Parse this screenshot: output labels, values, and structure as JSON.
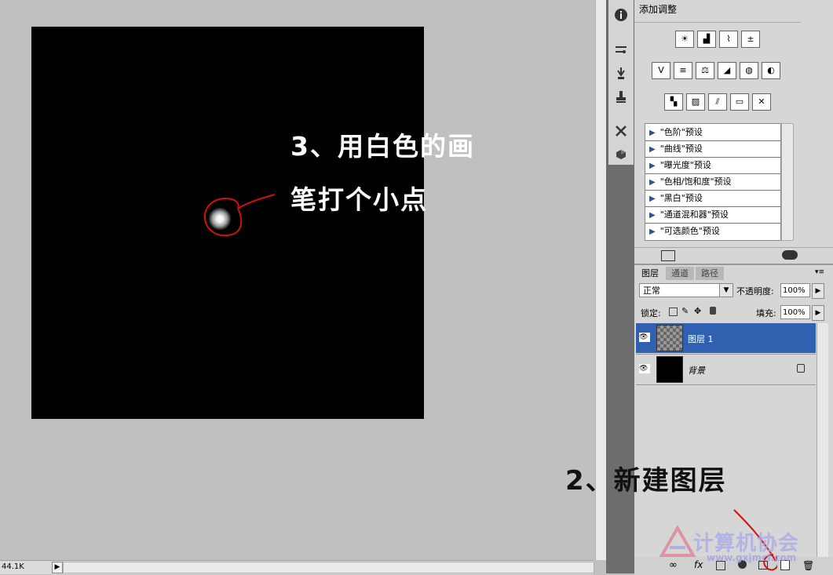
{
  "canvas": {
    "annotation_line1": "3、用白色的画",
    "annotation_line2": "笔打个小点"
  },
  "status": {
    "zoom": "44.1K",
    "arrow": "▶"
  },
  "layers_annotation": "2、新建图层",
  "adjustments": {
    "title": "添加调整",
    "row1_icons": [
      "brightness-icon",
      "levels-icon",
      "curves-icon",
      "exposure-icon"
    ],
    "row2_icons": [
      "vibrance-icon",
      "hue-saturation-icon",
      "color-balance-icon",
      "black-white-icon",
      "photo-filter-icon",
      "channel-mixer-icon"
    ],
    "row3_icons": [
      "invert-icon",
      "posterize-icon",
      "threshold-icon",
      "gradient-map-icon",
      "selective-color-icon"
    ],
    "presets": [
      "\"色阶\"预设",
      "\"曲线\"预设",
      "\"曝光度\"预设",
      "\"色相/饱和度\"预设",
      "\"黑白\"预设",
      "\"通道混和器\"预设",
      "\"可选颜色\"预设"
    ]
  },
  "layers": {
    "tabs": [
      "图层",
      "通道",
      "路径"
    ],
    "blend_mode": "正常",
    "opacity_label": "不透明度:",
    "opacity_value": "100%",
    "lock_label": "锁定:",
    "fill_label": "填充:",
    "fill_value": "100%",
    "items": [
      {
        "name": "图层 1",
        "selected": true
      },
      {
        "name": "背景",
        "selected": false
      }
    ]
  },
  "watermark": {
    "text": "计算机协会",
    "url": "www.gxjmcf.com"
  },
  "colors": {
    "selected_layer": "#3060b0",
    "annotation_red": "#d01010"
  }
}
